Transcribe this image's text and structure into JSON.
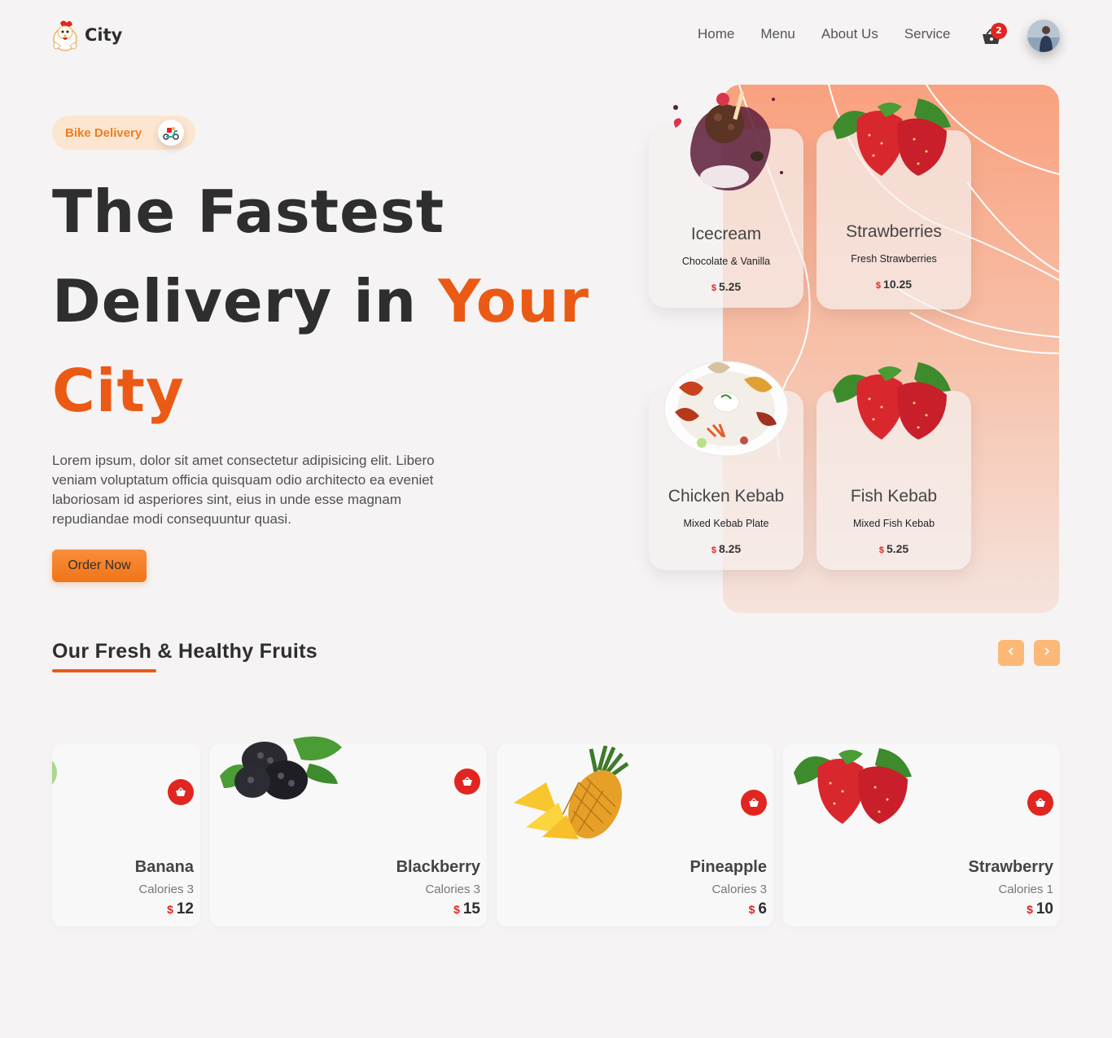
{
  "brand": {
    "name": "City"
  },
  "nav": {
    "items": [
      "Home",
      "Menu",
      "About Us",
      "Service"
    ]
  },
  "cart": {
    "count": "2"
  },
  "hero": {
    "pill_label": "Bike Delivery",
    "title_line1": "The Fastest",
    "title_line2_plain": "Delivery in ",
    "title_line2_accent": "Your",
    "title_line3_accent": "City",
    "description": "Lorem ipsum, dolor sit amet consectetur adipisicing elit. Libero veniam voluptatum officia quisquam odio architecto ea eveniet laboriosam id asperiores sint, eius in unde esse magnam repudiandae modi consequuntur quasi.",
    "cta_label": "Order Now"
  },
  "featured": [
    {
      "name": "Icecream",
      "subtitle": "Chocolate & Vanilla",
      "currency": "$",
      "price": "5.25",
      "icon": "icecream-icon"
    },
    {
      "name": "Strawberries",
      "subtitle": "Fresh Strawberries",
      "currency": "$",
      "price": "10.25",
      "icon": "strawberry-icon"
    },
    {
      "name": "Chicken Kebab",
      "subtitle": "Mixed Kebab Plate",
      "currency": "$",
      "price": "8.25",
      "icon": "kebab-plate-icon"
    },
    {
      "name": "Fish Kebab",
      "subtitle": "Mixed Fish Kebab",
      "currency": "$",
      "price": "5.25",
      "icon": "strawberry-icon"
    }
  ],
  "fruits_section": {
    "title": "Our Fresh & Healthy Fruits",
    "prev_icon": "chevron-left-icon",
    "next_icon": "chevron-right-icon",
    "items": [
      {
        "name": "Banana",
        "calories": "Calories 3",
        "currency": "$",
        "price": "12"
      },
      {
        "name": "Blackberry",
        "calories": "Calories 3",
        "currency": "$",
        "price": "15"
      },
      {
        "name": "Pineapple",
        "calories": "Calories 3",
        "currency": "$",
        "price": "6"
      },
      {
        "name": "Strawberry",
        "calories": "Calories 1",
        "currency": "$",
        "price": "10"
      }
    ]
  },
  "colors": {
    "accent": "#eb5a14",
    "orange_button": "#f98e3a",
    "red": "#e12621",
    "background": "#f5f3f3"
  }
}
